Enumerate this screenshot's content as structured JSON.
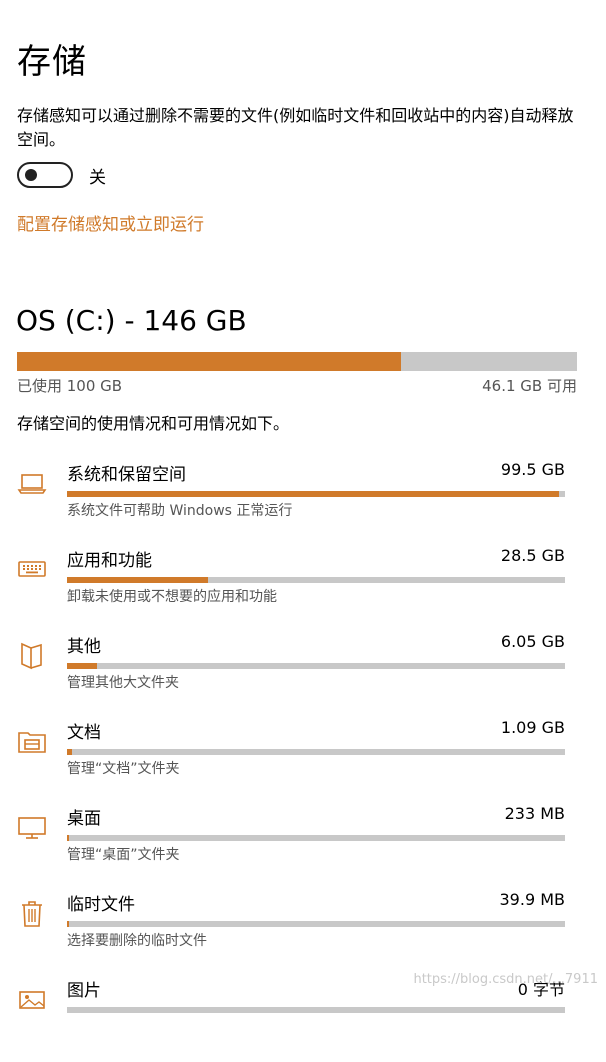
{
  "page": {
    "title": "存储",
    "description": "存储感知可以通过删除不需要的文件(例如临时文件和回收站中的内容)自动释放空间。",
    "toggle_label": "关",
    "toggle_state": "off",
    "link_text": "配置存储感知或立即运行"
  },
  "drive": {
    "title": "OS (C:) - 146 GB",
    "used_label": "已使用 100 GB",
    "free_label": "46.1 GB 可用",
    "used_fraction": 0.685
  },
  "summary": "存储空间的使用情况和可用情况如下。",
  "categories": [
    {
      "name": "系统和保留空间",
      "size": "99.5 GB",
      "sub": "系统文件可帮助 Windows 正常运行",
      "fraction": 0.988,
      "icon": "laptop-icon"
    },
    {
      "name": "应用和功能",
      "size": "28.5 GB",
      "sub": "卸载未使用或不想要的应用和功能",
      "fraction": 0.283,
      "icon": "keyboard-icon"
    },
    {
      "name": "其他",
      "size": "6.05 GB",
      "sub": "管理其他大文件夹",
      "fraction": 0.06,
      "icon": "other-files-icon"
    },
    {
      "name": "文档",
      "size": "1.09 GB",
      "sub": "管理“文档”文件夹",
      "fraction": 0.011,
      "icon": "documents-folder-icon"
    },
    {
      "name": "桌面",
      "size": "233 MB",
      "sub": "管理“桌面”文件夹",
      "fraction": 0.002,
      "icon": "desktop-monitor-icon"
    },
    {
      "name": "临时文件",
      "size": "39.9 MB",
      "sub": "选择要删除的临时文件",
      "fraction": 0.0005,
      "icon": "trash-icon"
    },
    {
      "name": "图片",
      "size": "0 字节",
      "sub": "",
      "fraction": 0,
      "icon": "pictures-icon"
    }
  ],
  "watermark": "https://blog.csdn.net/...7911",
  "colors": {
    "accent": "#d07a2a",
    "track": "#c8c8c8"
  }
}
